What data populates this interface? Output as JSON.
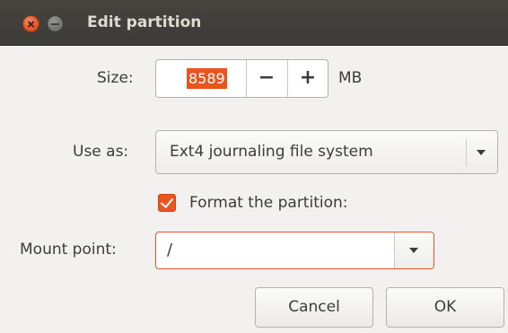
{
  "window": {
    "title": "Edit partition",
    "accent_color": "#e95420",
    "titlebar_color": "#3c3b37"
  },
  "titlebar_controls": {
    "close_icon": "close-icon",
    "minimize_icon": "minimize-icon"
  },
  "size": {
    "label": "Size:",
    "value": "8589",
    "decrement_label": "−",
    "increment_label": "+",
    "unit": "MB"
  },
  "use_as": {
    "label": "Use as:",
    "selected": "Ext4 journaling file system"
  },
  "format": {
    "label": "Format the partition:",
    "checked": true
  },
  "mount_point": {
    "label": "Mount point:",
    "value": "/"
  },
  "buttons": {
    "cancel_label": "Cancel",
    "ok_label": "OK"
  }
}
